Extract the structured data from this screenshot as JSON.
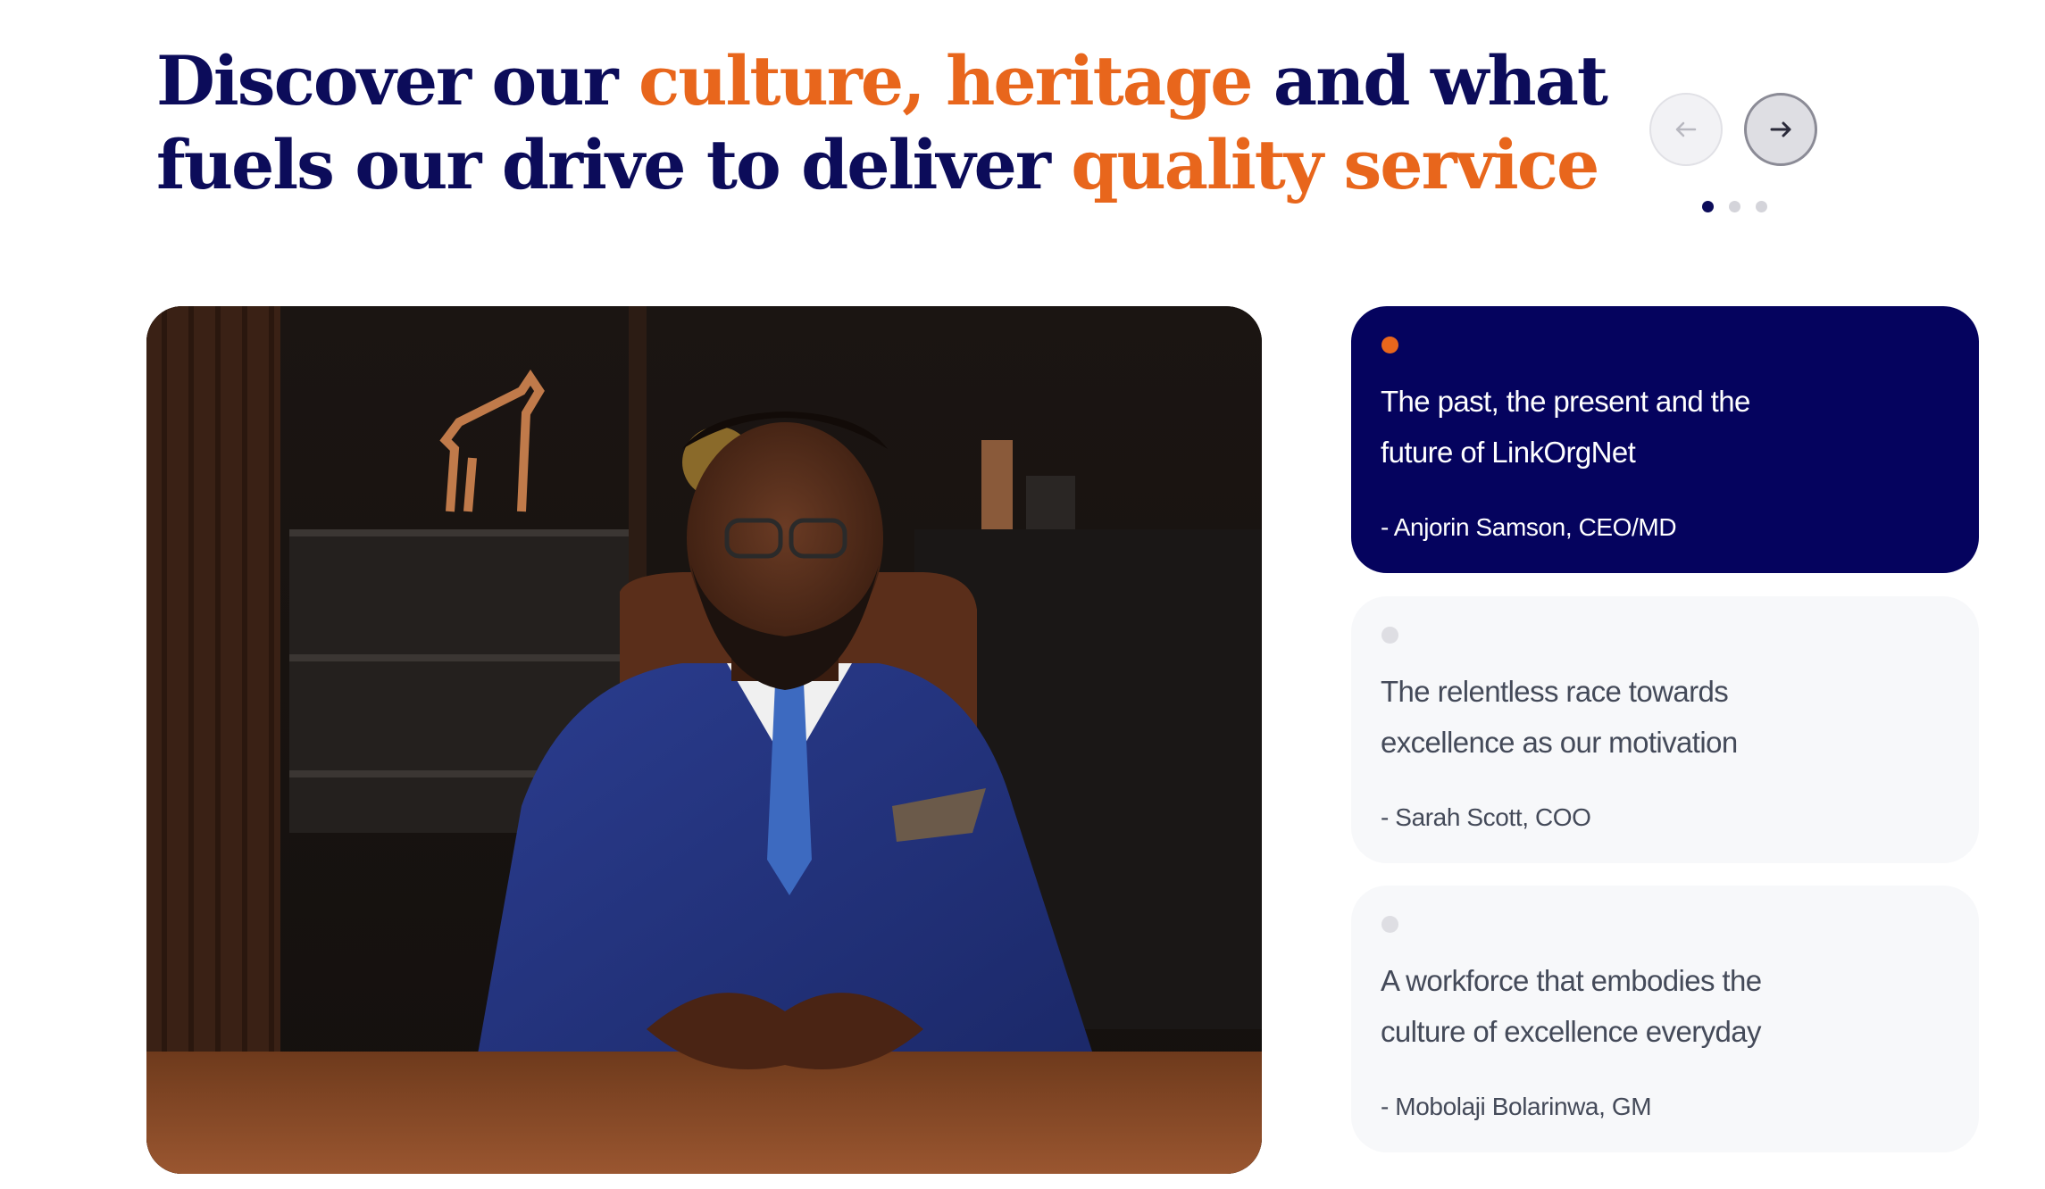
{
  "headline": {
    "line1_part1": "Discover our ",
    "line1_accent": "culture, heritage",
    "line1_part2": " and what",
    "line2_part1": "fuels our drive to deliver ",
    "line2_accent": "quality service"
  },
  "carousel": {
    "prev_icon": "arrow-left-icon",
    "next_icon": "arrow-right-icon",
    "pages": 3,
    "active_page": 1
  },
  "photo": {
    "subject": "executive-portrait"
  },
  "stories": [
    {
      "title": "The past, the present and the future of LinkOrgNet",
      "author": "- Anjorin Samson, CEO/MD",
      "active": true
    },
    {
      "title": "The relentless race towards excellence as our motivation",
      "author": "- Sarah Scott, COO",
      "active": false
    },
    {
      "title": "A workforce that embodies the culture of excellence everyday",
      "author": "- Mobolaji Bolarinwa, GM",
      "active": false
    }
  ],
  "colors": {
    "navy": "#0c0c5a",
    "card_active": "#05035e",
    "accent": "#e8661c",
    "card_inactive": "#f7f8fa"
  }
}
